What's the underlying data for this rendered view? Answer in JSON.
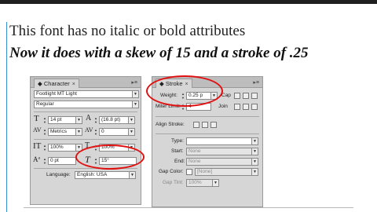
{
  "text": {
    "line1": "This font has no italic or bold attributes",
    "line2": "Now it does with a skew of 15 and a stroke of .25"
  },
  "character_panel": {
    "tab_label": "Character",
    "tab_close": "×",
    "font_family": "Footlight MT Light",
    "font_style": "Regular",
    "font_size": "14 pt",
    "leading": "(16.8 pt)",
    "kerning": "Metrics",
    "tracking": "0",
    "vertical_scale": "100%",
    "horizontal_scale": "100%",
    "baseline_shift": "0 pt",
    "skew": "15°",
    "language_label": "Language:",
    "language": "English: USA"
  },
  "stroke_panel": {
    "tab_label": "Stroke",
    "tab_close": "×",
    "weight_label": "Weight:",
    "weight": "0.25 p",
    "cap_label": "Cap",
    "join_label": "Join",
    "miter_label": "Miter Limit:",
    "miter": "4",
    "align_label": "Align Stroke:",
    "type_label": "Type:",
    "start_label": "Start:",
    "start": "None",
    "end_label": "End:",
    "end": "None",
    "gap_color_label": "Gap Color:",
    "gap_color": "[None]",
    "gap_tint_label": "Gap Tint:",
    "gap_tint": "100%"
  },
  "colors": {
    "highlight": "#e01010",
    "panel_bg": "#d6d6d6",
    "frame": "#3a8fd0"
  }
}
